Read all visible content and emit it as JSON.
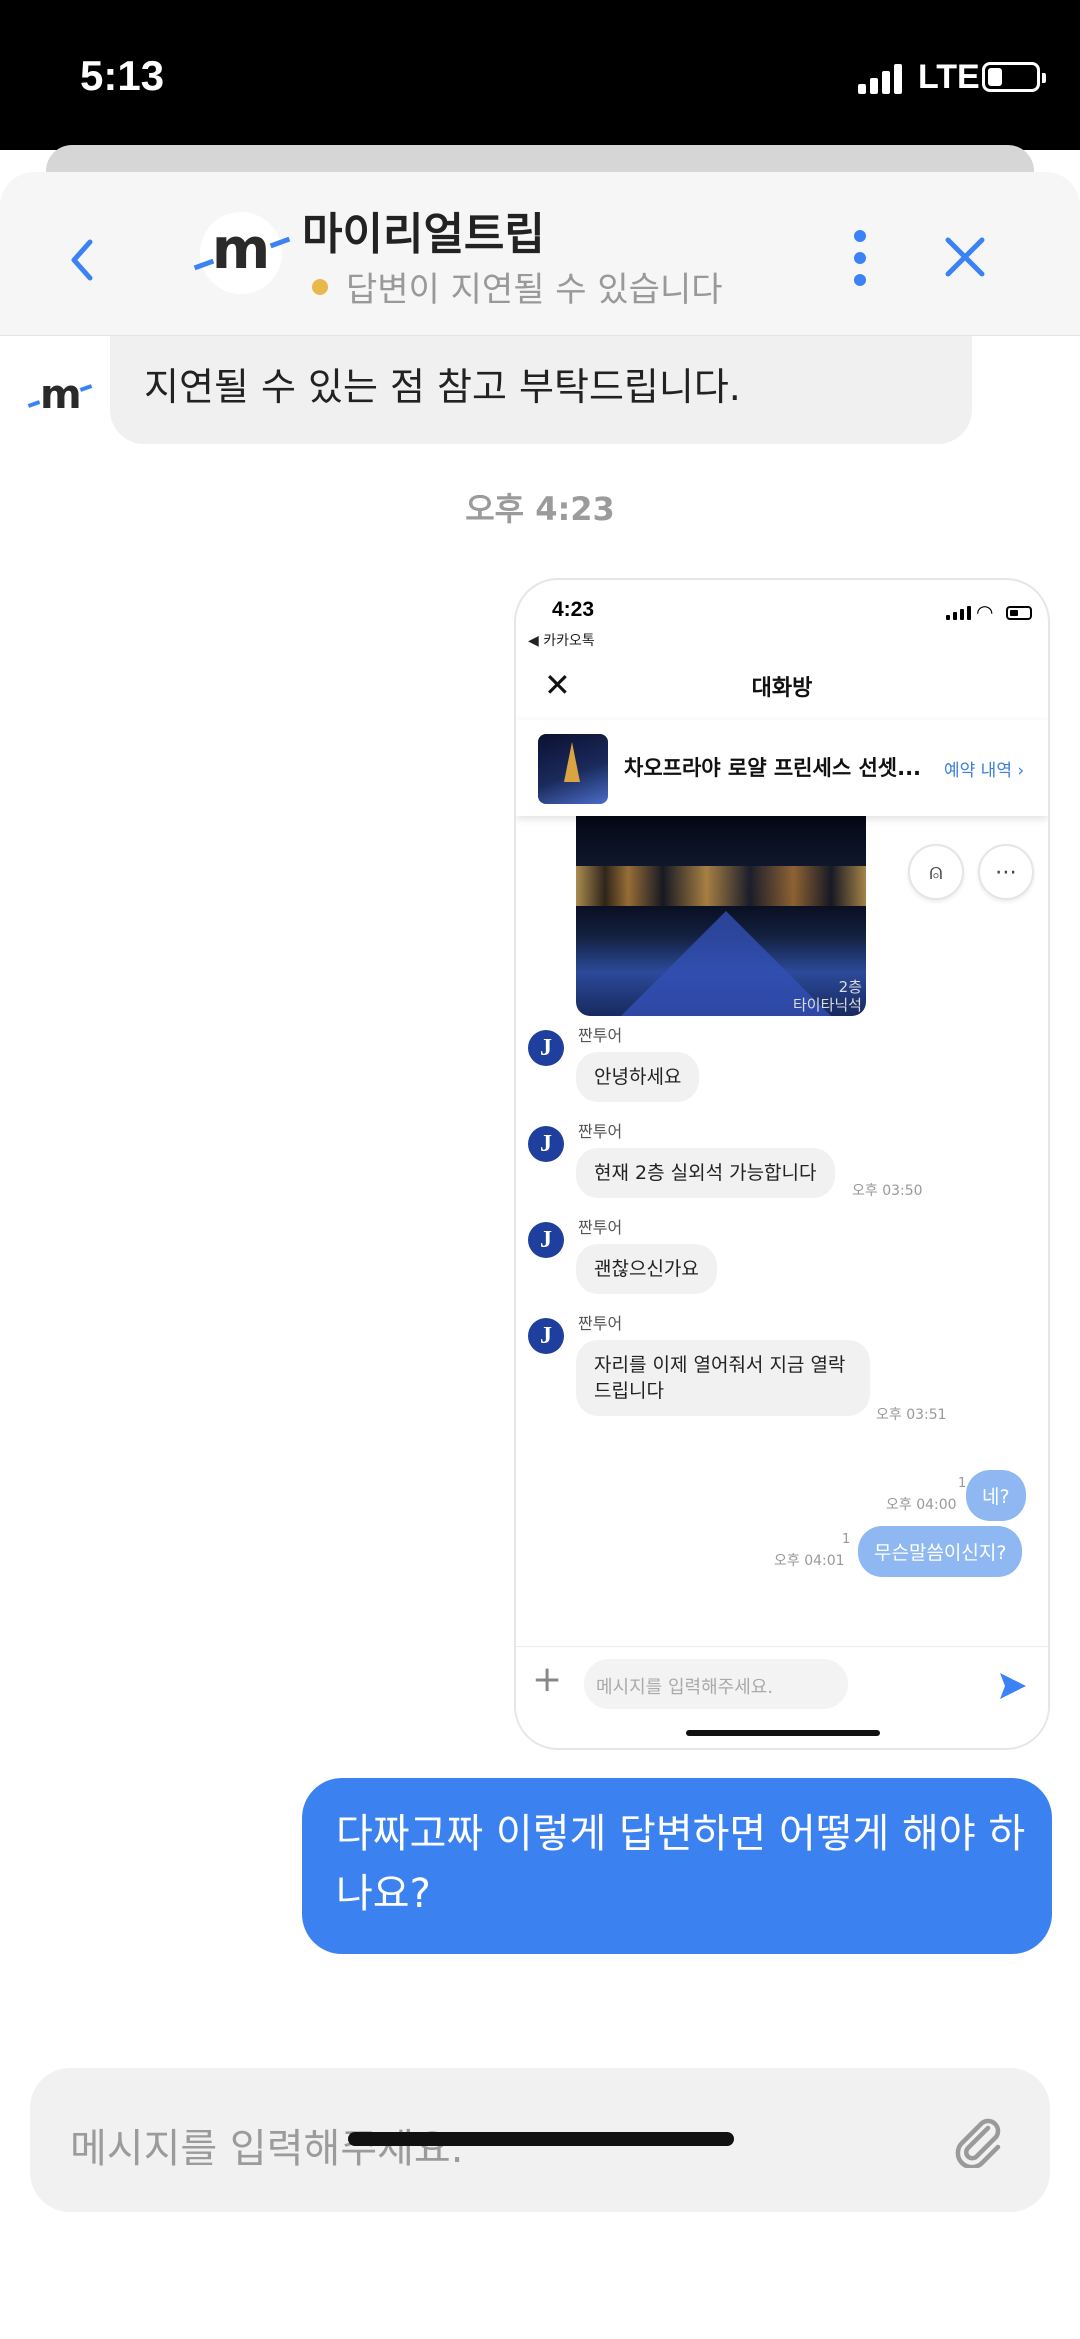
{
  "status_bar": {
    "time": "5:13",
    "network": "LTE"
  },
  "header": {
    "title": "마이리얼트립",
    "subtitle": "답변이 지연될 수 있습니다",
    "logo_letter": "m",
    "status_dot_color": "#e8b84a"
  },
  "chat": {
    "bot_message": "지연될 수 있는 점 참고 부탁드립니다.",
    "timestamp": "오후 4:23",
    "user_message": "다짜고짜 이렇게 답변하면 어떻게 해야 하나요?"
  },
  "screenshot": {
    "time": "4:23",
    "back_app": "◀ 카카오톡",
    "title": "대화방",
    "product_name": "차오프라야 로얄 프린세스 선셋...",
    "reserve_link": "예약 내역",
    "photo_label_floor": "2층",
    "photo_label_seat": "타이타닉석",
    "messages": [
      {
        "sender": "짠투어",
        "text": "안녕하세요",
        "time": ""
      },
      {
        "sender": "짠투어",
        "text": "현재 2층 실외석 가능합니다",
        "time": "오후 03:50"
      },
      {
        "sender": "짠투어",
        "text": "괜찮으신가요",
        "time": ""
      },
      {
        "sender": "짠투어",
        "text": "자리를 이제 열어줘서 지금 열락드립니다",
        "time": "오후 03:51"
      }
    ],
    "my_messages": [
      {
        "text": "네?",
        "time": "오후 04:00",
        "read": "1"
      },
      {
        "text": "무슨말씀이신지?",
        "time": "오후 04:01",
        "read": "1"
      }
    ],
    "input_placeholder": "메시지를 입력해주세요."
  },
  "input": {
    "placeholder": "메시지를 입력해주세요."
  },
  "colors": {
    "accent": "#3b82f0",
    "bubble_gray": "#f0f0f0",
    "my_bubble_light": "#8fb8f2"
  }
}
